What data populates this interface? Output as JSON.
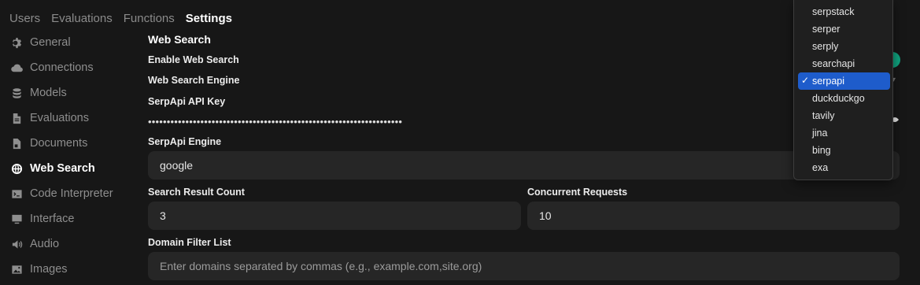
{
  "top_nav": [
    "Users",
    "Evaluations",
    "Functions",
    "Settings"
  ],
  "sidebar": {
    "items": [
      {
        "label": "General",
        "icon": "gear-icon"
      },
      {
        "label": "Connections",
        "icon": "cloud-icon"
      },
      {
        "label": "Models",
        "icon": "database-icon"
      },
      {
        "label": "Evaluations",
        "icon": "document-icon"
      },
      {
        "label": "Documents",
        "icon": "file-icon"
      },
      {
        "label": "Web Search",
        "icon": "globe-icon"
      },
      {
        "label": "Code Interpreter",
        "icon": "terminal-icon"
      },
      {
        "label": "Interface",
        "icon": "monitor-icon"
      },
      {
        "label": "Audio",
        "icon": "speaker-icon"
      },
      {
        "label": "Images",
        "icon": "image-icon"
      }
    ]
  },
  "main": {
    "section_title": "Web Search",
    "enable_label": "Enable Web Search",
    "engine_label": "Web Search Engine",
    "api_key_label": "SerpApi API Key",
    "api_key_masked": "••••••••••••••••••••••••••••••••••••••••••••••••••••••••••••••••••••",
    "serpapi_engine_label": "SerpApi Engine",
    "serpapi_engine_value": "google",
    "result_count_label": "Search Result Count",
    "result_count_value": "3",
    "concurrent_label": "Concurrent Requests",
    "concurrent_value": "10",
    "domain_filter_label": "Domain Filter List",
    "domain_filter_placeholder": "Enter domains separated by commas (e.g., example.com,site.org)"
  },
  "dropdown": {
    "options": [
      "serpstack",
      "serper",
      "serply",
      "searchapi",
      "serpapi",
      "duckduckgo",
      "tavily",
      "jina",
      "bing",
      "exa"
    ],
    "selected": "serpapi",
    "check_mark": "✓"
  },
  "colors": {
    "background": "#171717",
    "field": "#262626",
    "accent": "#1e5ccb",
    "toggle": "#10a37f"
  }
}
